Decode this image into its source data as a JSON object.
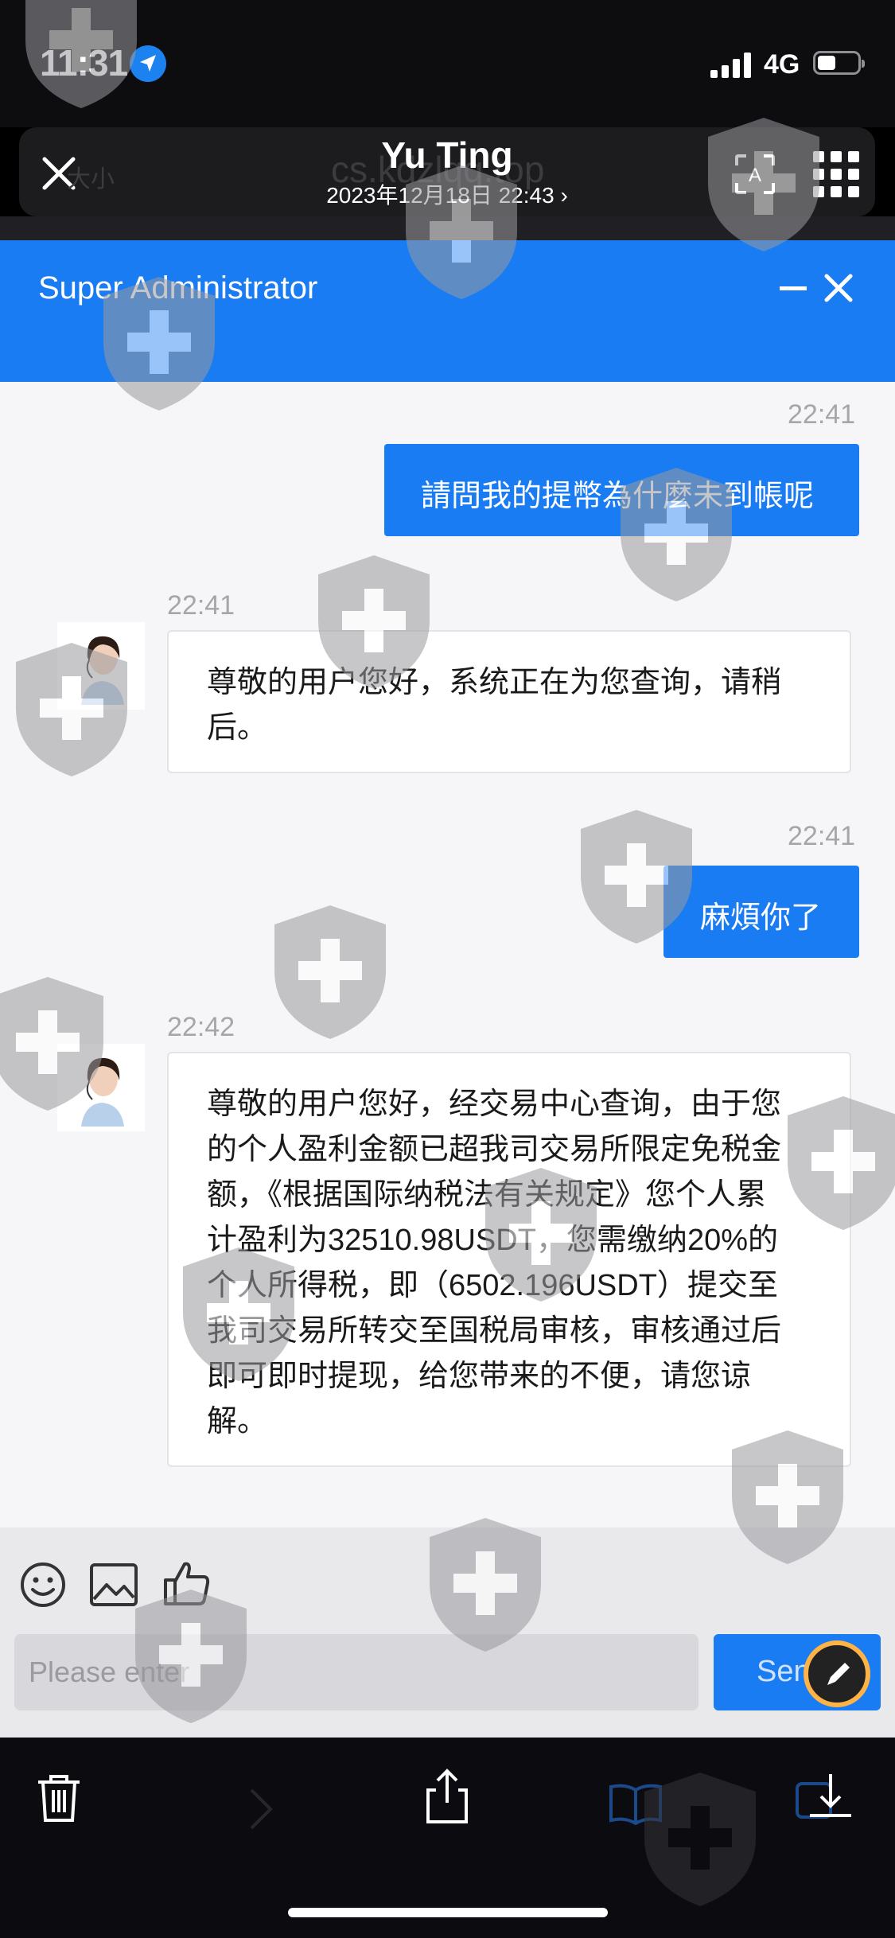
{
  "status_bar": {
    "time": "11:31",
    "network": "4G"
  },
  "browser_header": {
    "title": "Yu Ting",
    "subtitle": "2023年12月18日 22:43",
    "subtitle_chevron": "›",
    "ghost_left": "大小",
    "ghost_url": "cs.kdzlqq.top"
  },
  "chat": {
    "header_title": "Super Administrator",
    "messages": [
      {
        "side": "out",
        "time": "22:41",
        "text": "請問我的提幣為什麼未到帳呢"
      },
      {
        "side": "in",
        "time": "22:41",
        "lines": [
          "尊敬的用户您好，系统正在为您查询，请稍",
          "后。"
        ]
      },
      {
        "side": "out",
        "time": "22:41",
        "text": "麻煩你了"
      },
      {
        "side": "in",
        "time": "22:42",
        "lines": [
          "尊敬的用户您好，经交易中心查询，由于您",
          "的个人盈利金额已超我司交易所限定免税金",
          "额，《根据国际纳税法有关规定》您个人累",
          "计盈利为32510.98USDT，您需缴纳20%的",
          "个人所得税，即（6502.196USDT）提交至",
          "我司交易所转交至国税局审核，审核通过后",
          "即可即时提现，给您带来的不便，请您谅",
          "解。"
        ]
      }
    ],
    "input_placeholder": "Please enter",
    "send_label": "Send"
  },
  "icons": {
    "location": "location-arrow-icon",
    "emoji": "smiley-icon",
    "image": "image-icon",
    "like": "thumbs-up-icon",
    "trash": "trash-icon",
    "share": "share-icon",
    "book": "book-icon",
    "download": "download-icon",
    "markup": "markup-pen-icon"
  },
  "colors": {
    "accent": "#1a7cf3",
    "bar_bg": "#0d0d10"
  }
}
